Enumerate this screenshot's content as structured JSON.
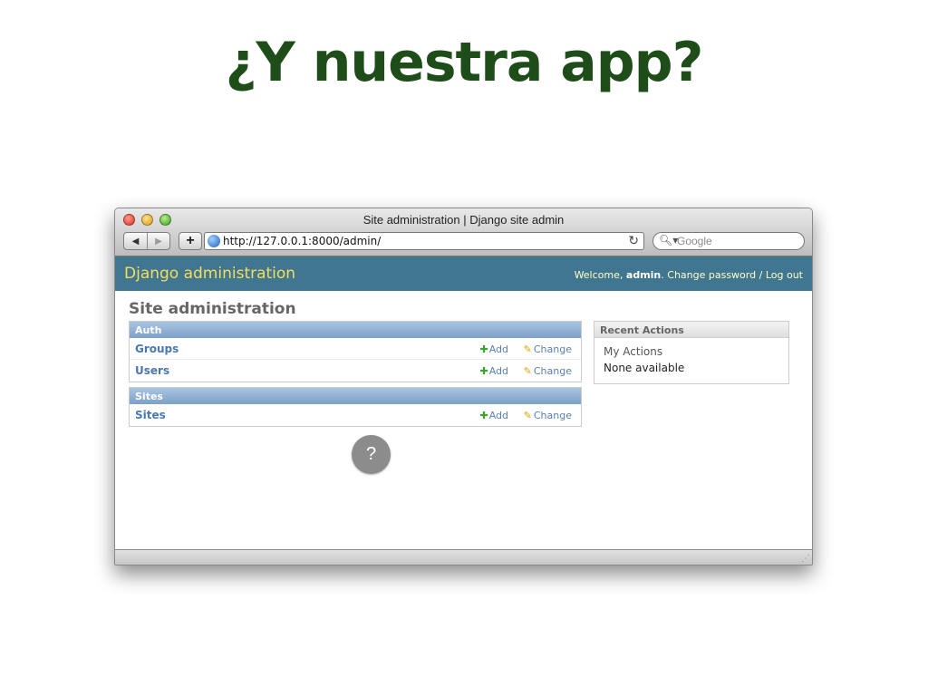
{
  "slide": {
    "title": "¿Y nuestra app?"
  },
  "browser": {
    "window_title": "Site administration | Django site admin",
    "url": "http://127.0.0.1:8000/admin/",
    "search_placeholder": "Google",
    "back_icon": "◀",
    "forward_icon": "▶",
    "add_tab_icon": "+",
    "reload_icon": "↻",
    "search_icon": "🔍︎▾"
  },
  "header": {
    "branding": "Django administration",
    "welcome": "Welcome,",
    "username": "admin",
    "change_password": "Change password",
    "separator": "/",
    "logout": "Log out"
  },
  "main": {
    "title": "Site administration",
    "modules": [
      {
        "caption": "Auth",
        "models": [
          {
            "name": "Groups",
            "add": "Add",
            "change": "Change"
          },
          {
            "name": "Users",
            "add": "Add",
            "change": "Change"
          }
        ]
      },
      {
        "caption": "Sites",
        "models": [
          {
            "name": "Sites",
            "add": "Add",
            "change": "Change"
          }
        ]
      }
    ]
  },
  "sidebar": {
    "caption": "Recent Actions",
    "heading": "My Actions",
    "empty": "None available"
  },
  "overlay": {
    "badge": "?"
  },
  "colors": {
    "header_bg": "#417690",
    "branding": "#f5dd5d",
    "title_green": "#1f4d1a"
  }
}
